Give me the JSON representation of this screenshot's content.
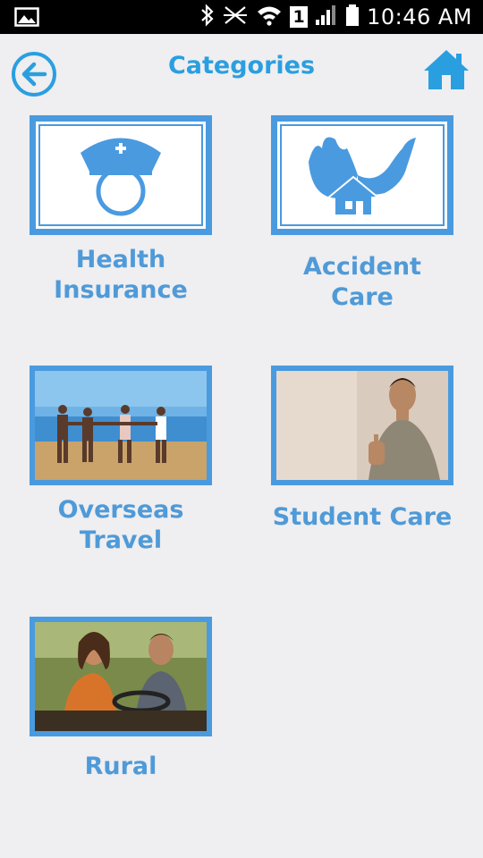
{
  "status_bar": {
    "time": "10:46 AM",
    "sim_badge": "1"
  },
  "header": {
    "title": "Categories"
  },
  "categories": [
    {
      "label_line1": "Health",
      "label_line2": "Insurance"
    },
    {
      "label_line1": "Accident Care"
    },
    {
      "label_line1": "Overseas",
      "label_line2": "Travel"
    },
    {
      "label_line1": "Student Care"
    },
    {
      "label_line1": "Rural"
    }
  ],
  "colors": {
    "accent": "#2a9fe0",
    "frame": "#4a9ae0",
    "label": "#4f9ad8",
    "background": "#efeef0"
  },
  "icons": {
    "back": "arrow-left-circle-icon",
    "home": "house-icon",
    "health": "nurse-cap-icon",
    "accident": "house-fire-icon"
  }
}
